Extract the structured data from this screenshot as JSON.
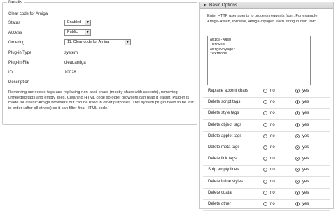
{
  "details": {
    "legend": "Details",
    "plugin_name": "Clear code for Amiga",
    "fields": [
      {
        "label": "Status",
        "value": "Enabled",
        "type": "select"
      },
      {
        "label": "Access",
        "value": "Public",
        "type": "select"
      },
      {
        "label": "Ordering",
        "value": "11. Clear code for Amiga",
        "type": "select"
      },
      {
        "label": "Plug-in Type",
        "value": "system",
        "type": "text"
      },
      {
        "label": "Plug-in File",
        "value": "clear.amiga",
        "type": "text"
      },
      {
        "label": "ID",
        "value": "10028",
        "type": "text"
      },
      {
        "label": "Description",
        "value": "",
        "type": "text"
      }
    ],
    "description": "Removing unneeded tags and replacing non-ascii chars (mostly chars with accents), removing unneeded tags and empty lines. Cleaning HTML code so older browsers can read it easier. Plug-in is made for classic Amiga browsers but can be used in other purposes. This system plugin need to be last in order (after all others) so it can filter final HTML code."
  },
  "basic_options": {
    "header": "Basic Options",
    "agents_label": "Enter HTTP user agents to process requests from. For example: Amiga-AWeb, IBrowse, AmigaVoyager, each string in own row:",
    "agents_value": "Amiga-AWeb\nIBrowse\nAmigaVoyager\ntextmode",
    "no_label": "no",
    "yes_label": "yes",
    "options": [
      {
        "label": "Replace accent chars",
        "selected": "yes"
      },
      {
        "label": "Delete script tags",
        "selected": "yes"
      },
      {
        "label": "Delete style tags",
        "selected": "yes"
      },
      {
        "label": "Delete object tags",
        "selected": "yes"
      },
      {
        "label": "Delete applet tags",
        "selected": "yes"
      },
      {
        "label": "Delete meta tags",
        "selected": "yes"
      },
      {
        "label": "Delete link tags",
        "selected": "yes"
      },
      {
        "label": "Strip empty lines",
        "selected": "yes"
      },
      {
        "label": "Delete inline styles",
        "selected": "yes"
      },
      {
        "label": "Delete cdata",
        "selected": "yes"
      },
      {
        "label": "Delete other",
        "selected": "yes"
      }
    ]
  }
}
